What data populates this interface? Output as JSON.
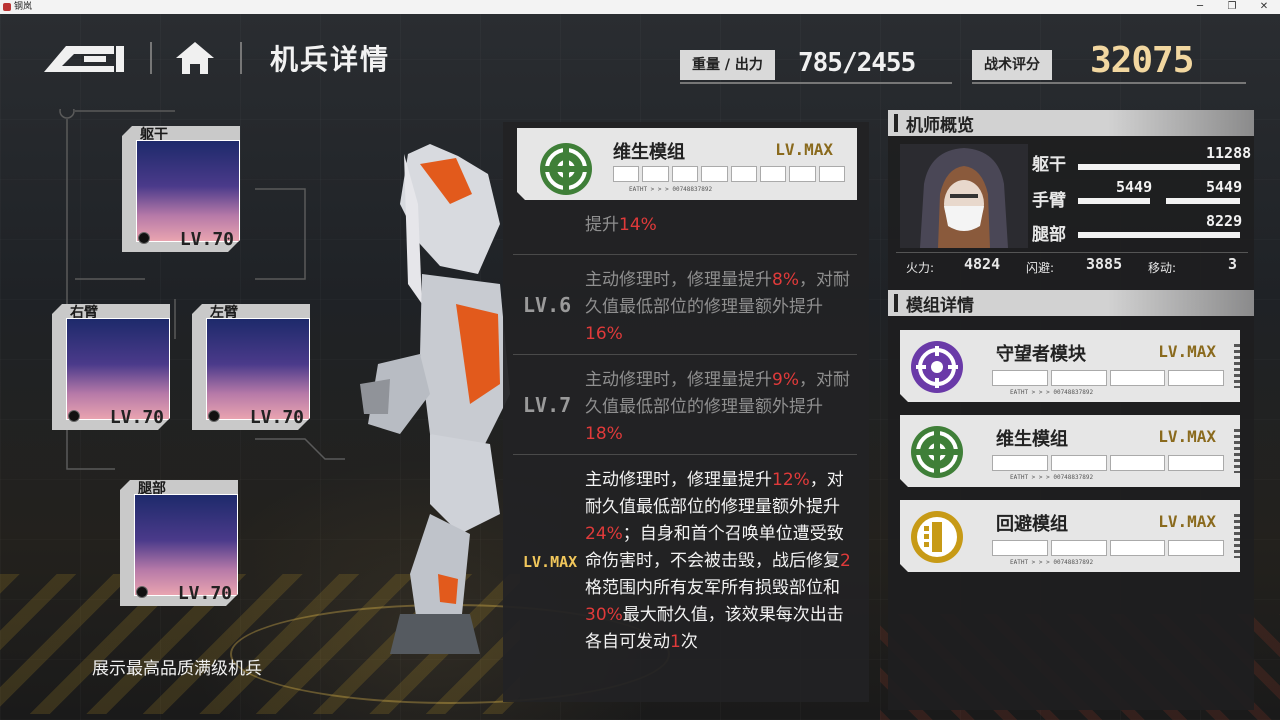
{
  "window": {
    "title": "钢岚"
  },
  "nav": {
    "page_title": "机兵详情"
  },
  "stats": {
    "weight_label": "重量 / 出力",
    "weight_value": "785/2455",
    "score_label": "战术评分",
    "score_value": "32075"
  },
  "parts": [
    {
      "label": "躯干",
      "level": "LV.70"
    },
    {
      "label": "右臂",
      "level": "LV.70"
    },
    {
      "label": "左臂",
      "level": "LV.70"
    },
    {
      "label": "腿部",
      "level": "LV.70"
    }
  ],
  "footer_note": "展示最高品质满级机兵",
  "module_detail": {
    "name": "维生模组",
    "level": "LV.MAX",
    "code": "EATHT > > > 00748837892",
    "level_rows": [
      {
        "tag": "",
        "segments": [
          {
            "t": "提升",
            "red": false
          },
          {
            "t": "14%",
            "red": true
          }
        ]
      },
      {
        "tag": "LV.6",
        "segments": [
          {
            "t": "主动修理时，修理量提升",
            "red": false
          },
          {
            "t": "8%",
            "red": true
          },
          {
            "t": "，对耐久值最低部位的修理量额外提升",
            "red": false
          },
          {
            "t": "16%",
            "red": true
          }
        ]
      },
      {
        "tag": "LV.7",
        "segments": [
          {
            "t": "主动修理时，修理量提升",
            "red": false
          },
          {
            "t": "9%",
            "red": true
          },
          {
            "t": "，对耐久值最低部位的修理量额外提升",
            "red": false
          },
          {
            "t": "18%",
            "red": true
          }
        ]
      },
      {
        "tag": "LV.MAX",
        "segments": [
          {
            "t": "主动修理时，修理量提升",
            "red": false
          },
          {
            "t": "12%",
            "red": true
          },
          {
            "t": "，对耐久值最低部位的修理量额外提升",
            "red": false
          },
          {
            "t": "24%",
            "red": true
          },
          {
            "t": "；自身和首个召唤单位遭受致命伤害时，不会被击毁，战后修复",
            "red": false
          },
          {
            "t": "2",
            "red": true
          },
          {
            "t": "格范围内所有友军所有损毁部位和",
            "red": false
          },
          {
            "t": "30%",
            "red": true
          },
          {
            "t": "最大耐久值，该效果每次出击各自可发动",
            "red": false
          },
          {
            "t": "1",
            "red": true
          },
          {
            "t": "次",
            "red": false
          }
        ]
      }
    ]
  },
  "pilot": {
    "section_title": "机师概览",
    "torso_label": "躯干",
    "torso_value": "11288",
    "arm_label": "手臂",
    "arm_left_value": "5449",
    "arm_right_value": "5449",
    "leg_label": "腿部",
    "leg_value": "8229",
    "firepower_label": "火力:",
    "firepower_value": "4824",
    "evasion_label": "闪避:",
    "evasion_value": "3885",
    "move_label": "移动:",
    "move_value": "3"
  },
  "modules": {
    "section_title": "模组详情",
    "items": [
      {
        "name": "守望者模块",
        "level": "LV.MAX",
        "code": "EATHT > > > 00748837892",
        "color": "#6a3aa8"
      },
      {
        "name": "维生模组",
        "level": "LV.MAX",
        "code": "EATHT > > > 00748837892",
        "color": "#3f7f38"
      },
      {
        "name": "回避模组",
        "level": "LV.MAX",
        "code": "EATHT > > > 00748837892",
        "color": "#c79a16"
      }
    ]
  }
}
